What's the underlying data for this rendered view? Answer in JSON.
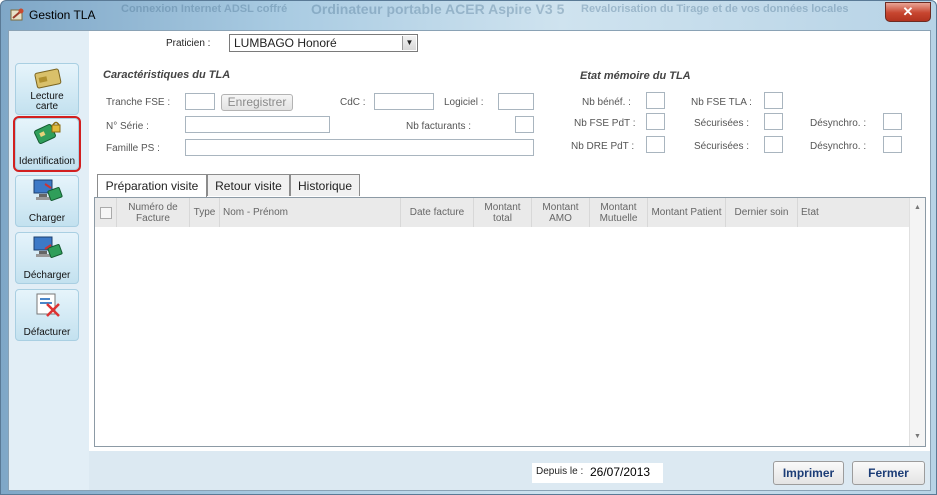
{
  "window": {
    "title": "Gestion TLA",
    "close_label": "✕"
  },
  "background_text": [
    "Connexion Internet ADSL coffré",
    "Ordinateur portable ACER Aspire V3 5",
    "Revalorisation du Tirage et de vos données locales"
  ],
  "sidebar": {
    "items": [
      {
        "label_line1": "Lecture",
        "label_line2": "carte",
        "icon": "card-reader-icon"
      },
      {
        "label_line1": "Identification",
        "label_line2": "",
        "icon": "identification-icon",
        "selected": true
      },
      {
        "label_line1": "Charger",
        "label_line2": "",
        "icon": "charger-icon"
      },
      {
        "label_line1": "Décharger",
        "label_line2": "",
        "icon": "decharger-icon"
      },
      {
        "label_line1": "Défacturer",
        "label_line2": "",
        "icon": "defacturer-icon"
      }
    ]
  },
  "praticien": {
    "label": "Praticien :",
    "value": "LUMBAGO Honoré"
  },
  "caracteristiques": {
    "title": "Caractéristiques du TLA",
    "tranche_fse_label": "Tranche FSE :",
    "tranche_fse_value": "",
    "enregistrer_label": "Enregistrer",
    "cdc_label": "CdC :",
    "cdc_value": "",
    "logiciel_label": "Logiciel :",
    "logiciel_value": "",
    "serie_label": "N° Série :",
    "serie_value": "",
    "nb_facturants_label": "Nb facturants :",
    "nb_facturants_value": "",
    "famille_label": "Famille PS :",
    "famille_value": ""
  },
  "etat_memoire": {
    "title": "Etat mémoire du TLA",
    "nb_benef_label": "Nb bénéf. :",
    "nb_fse_tla_label": "Nb FSE TLA :",
    "nb_fse_pdt_label": "Nb FSE PdT :",
    "nb_dre_pdt_label": "Nb DRE PdT :",
    "securisees_label": "Sécurisées :",
    "desynchro_label": "Désynchro. :"
  },
  "tabs": [
    {
      "label": "Préparation visite",
      "active": true
    },
    {
      "label": "Retour visite",
      "active": false
    },
    {
      "label": "Historique",
      "active": false
    }
  ],
  "table": {
    "columns": [
      "Numéro de Facture",
      "Type",
      "Nom - Prénom",
      "Date facture",
      "Montant total",
      "Montant AMO",
      "Montant Mutuelle",
      "Montant Patient",
      "Dernier soin",
      "Etat"
    ],
    "rows": []
  },
  "footer": {
    "depuis_label": "Depuis le :",
    "depuis_value": "26/07/2013",
    "imprimer_label": "Imprimer",
    "fermer_label": "Fermer"
  }
}
